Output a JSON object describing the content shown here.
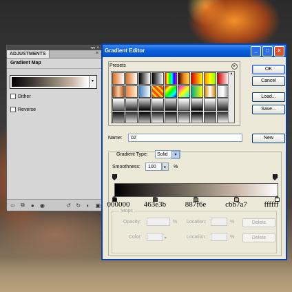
{
  "adjustments_panel": {
    "tab_label": "ADJUSTMENTS",
    "menu_icon": "panel-menu-icon",
    "title": "Gradient Map",
    "dither_label": "Dither",
    "reverse_label": "Reverse",
    "dither_checked": false,
    "reverse_checked": false
  },
  "editor": {
    "window_title": "Gradient Editor",
    "presets_label": "Presets",
    "buttons": {
      "ok": "OK",
      "cancel": "Cancel",
      "load": "Load...",
      "save": "Save...",
      "new": "New"
    },
    "name_label": "Name:",
    "name_value": "02",
    "gradient_type_label": "Gradient Type:",
    "gradient_type_value": "Solid",
    "smoothness_label": "Smoothness:",
    "smoothness_value": "100",
    "smoothness_unit": "%",
    "color_stops": [
      {
        "label": "000000",
        "color": "#000000",
        "location_pct": 0
      },
      {
        "label": "463e3b",
        "color": "#463e3b",
        "location_pct": 25
      },
      {
        "label": "887f6e",
        "color": "#887f6e",
        "location_pct": 50
      },
      {
        "label": "cbb7a7",
        "color": "#cbb7a7",
        "location_pct": 75
      },
      {
        "label": "ffffff",
        "color": "#ffffff",
        "location_pct": 100
      }
    ],
    "stops_section": {
      "label": "Stops",
      "opacity_label": "Opacity:",
      "color_label": "Color:",
      "location_label": "Location:",
      "pct": "%",
      "delete_label": "Delete"
    }
  },
  "colors": {
    "titlebar": "#0b5fdc",
    "window_bg": "#ece9d8"
  }
}
